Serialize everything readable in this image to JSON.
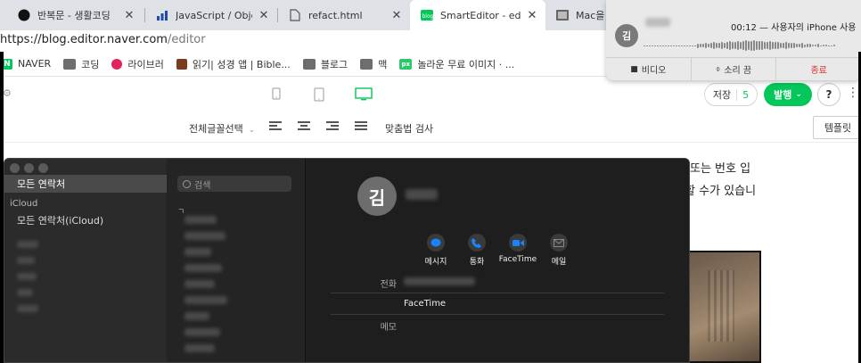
{
  "tabs": [
    {
      "label": "반복문 - 생활코딩",
      "icon": "opentutorials-icon",
      "active": false
    },
    {
      "label": "JavaScript / Object /",
      "icon": "codepen-icon",
      "active": false
    },
    {
      "label": "refact.html",
      "icon": "file-icon",
      "active": false
    },
    {
      "label": "SmartEditor - editor",
      "icon": "naver-blog-icon",
      "active": true
    },
    {
      "label": "Mac을 사용",
      "icon": "image-icon",
      "active": false
    }
  ],
  "url": {
    "host": "https://blog.editor.naver.com",
    "path": "/editor"
  },
  "bookmarks": [
    {
      "label": "NAVER",
      "icon": "naver-icon"
    },
    {
      "label": "코딩",
      "icon": "folder-icon"
    },
    {
      "label": "라이브러",
      "icon": "library-icon"
    },
    {
      "label": "읽기| 성경 앱 | Bible...",
      "icon": "bible-icon"
    },
    {
      "label": "블로그",
      "icon": "folder-icon"
    },
    {
      "label": "맥",
      "icon": "folder-icon"
    },
    {
      "label": "놀라운 무료 이미지 · ...",
      "icon": "pixabay-icon"
    }
  ],
  "editor": {
    "save_label": "저장",
    "save_count": "5",
    "publish_label": "발행",
    "help_label": "?",
    "more_label": "⋮",
    "font_select": "전체글꼴선택",
    "spell_check": "맞춤법 검사",
    "template_label": "템플릿",
    "body_line1": "또는 번호 입",
    "body_line2": "할 수가 있습니"
  },
  "contacts": {
    "all_contacts": "모든 연락처",
    "icloud_header": "iCloud",
    "icloud_all": "모든 연락처(iCloud)",
    "search_placeholder": "검색",
    "index_letter": "ㄱ",
    "contact_initial": "김",
    "actions": [
      {
        "label": "메시지",
        "icon": "message-icon",
        "color": "#1a82fb"
      },
      {
        "label": "통화",
        "icon": "phone-icon",
        "color": "#1a82fb"
      },
      {
        "label": "FaceTime",
        "icon": "video-icon",
        "color": "#1a82fb"
      },
      {
        "label": "메일",
        "icon": "mail-icon",
        "color": "#888888"
      }
    ],
    "phone_label": "전화",
    "facetime_label": "FaceTime",
    "memo_label": "메모"
  },
  "call": {
    "initial": "김",
    "title": "00:12 — 사용자의 iPhone 사용",
    "video": "비디오",
    "mute": "소리 끔",
    "end": "종료"
  },
  "colors": {
    "accent": "#03c75a",
    "end_call": "#e0312b",
    "facetime_blue": "#1a82fb"
  }
}
